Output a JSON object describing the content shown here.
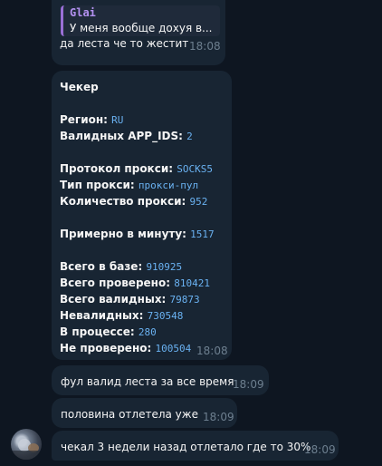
{
  "messages": {
    "first": {
      "reply_author": "Glai",
      "reply_text": "У меня вообще дохуя в...",
      "text": "да леста че то жестит",
      "time": "18:08"
    },
    "checker": {
      "title": "Чекер",
      "region_label": "Регион:",
      "region_value": "RU",
      "app_ids_label": "Валидных APP_IDS:",
      "app_ids_value": "2",
      "proxy_protocol_label": "Протокол прокси:",
      "proxy_protocol_value": "SOCKS5",
      "proxy_type_label": "Тип прокси:",
      "proxy_type_value": "прокси-пул",
      "proxy_count_label": "Количество прокси:",
      "proxy_count_value": "952",
      "per_minute_label": "Примерно в минуту:",
      "per_minute_value": "1517",
      "total_db_label": "Всего в базе:",
      "total_db_value": "910925",
      "total_checked_label": "Всего проверено:",
      "total_checked_value": "810421",
      "total_valid_label": "Всего валидных:",
      "total_valid_value": "79873",
      "invalid_label": "Невалидных:",
      "invalid_value": "730548",
      "in_progress_label": "В процессе:",
      "in_progress_value": "280",
      "not_checked_label": "Не проверено:",
      "not_checked_value": "100504",
      "time": "18:08"
    },
    "m3": {
      "text": "фул валид леста за все время",
      "time": "18:09"
    },
    "m4": {
      "text": "половина отлетела уже",
      "time": "18:09"
    },
    "m5": {
      "text": "чекал 3 недели назад отлетало где то 30%",
      "time": "18:09"
    }
  }
}
